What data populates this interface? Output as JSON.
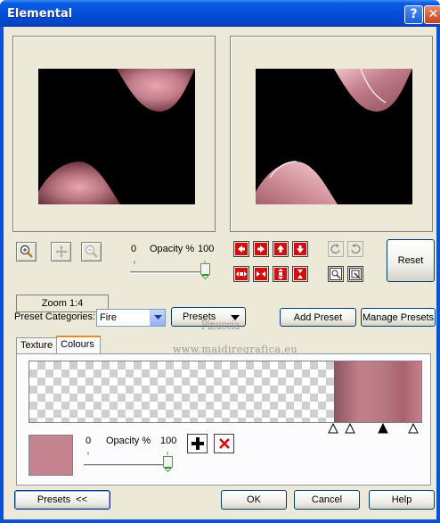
{
  "window": {
    "title": "Elemental",
    "help_glyph": "?",
    "close_glyph": "✕"
  },
  "preview": {
    "zoom_label": "Zoom 1:4",
    "opacity_label": "Opacity %",
    "opacity_min": "0",
    "opacity_max": "100",
    "opacity_value": 1.0,
    "reset_label": "Reset",
    "colors": {
      "background": "#000000",
      "shape": "#c07c88",
      "shape_dark": "#8a4b56"
    }
  },
  "presets": {
    "categories_label": "Preset Categories:",
    "category_value": "Fire",
    "presets_dropdown_label": "Presets",
    "add_preset_label": "Add Preset",
    "manage_presets_label": "Manage Presets"
  },
  "tabs": [
    {
      "label": "Texture",
      "active": false
    },
    {
      "label": "Colours",
      "active": true
    }
  ],
  "colours": {
    "opacity_label": "Opacity %",
    "opacity_min": "0",
    "opacity_max": "100",
    "opacity_value": 1.0,
    "swatch_color": "#c58590",
    "stops": [
      {
        "type": "outline"
      },
      {
        "type": "outline"
      },
      {
        "type": "filled"
      },
      {
        "type": "outline"
      }
    ]
  },
  "watermark": {
    "line1": "Pinuccia",
    "line2": "www.maidiregrafica.eu"
  },
  "footer": {
    "presets_toggle_label": "Presets  <<",
    "ok_label": "OK",
    "cancel_label": "Cancel",
    "help_label": "Help"
  }
}
